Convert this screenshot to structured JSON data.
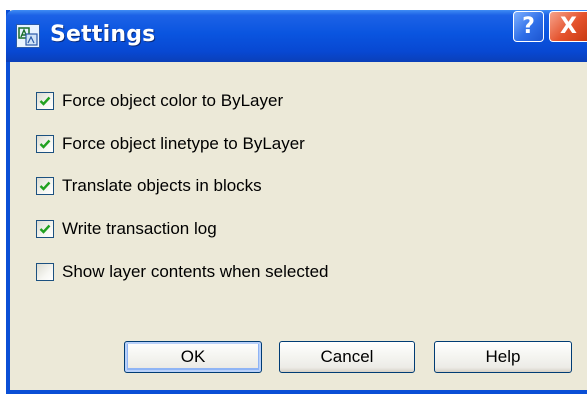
{
  "window": {
    "title": "Settings",
    "app_icon": "autocad-icon",
    "help_button_label": "?",
    "close_button_label": "X"
  },
  "options": [
    {
      "label": "Force object color to ByLayer",
      "checked": true
    },
    {
      "label": "Force object linetype to ByLayer",
      "checked": true
    },
    {
      "label": "Translate objects in blocks",
      "checked": true
    },
    {
      "label": "Write transaction log",
      "checked": true
    },
    {
      "label": "Show layer contents when selected",
      "checked": false
    }
  ],
  "buttons": {
    "ok_label": "OK",
    "cancel_label": "Cancel",
    "help_label": "Help"
  },
  "colors": {
    "titlebar": "#0a55e0",
    "dialog_bg": "#ece9d8",
    "check": "#21a121",
    "close_button": "#e4532d"
  }
}
